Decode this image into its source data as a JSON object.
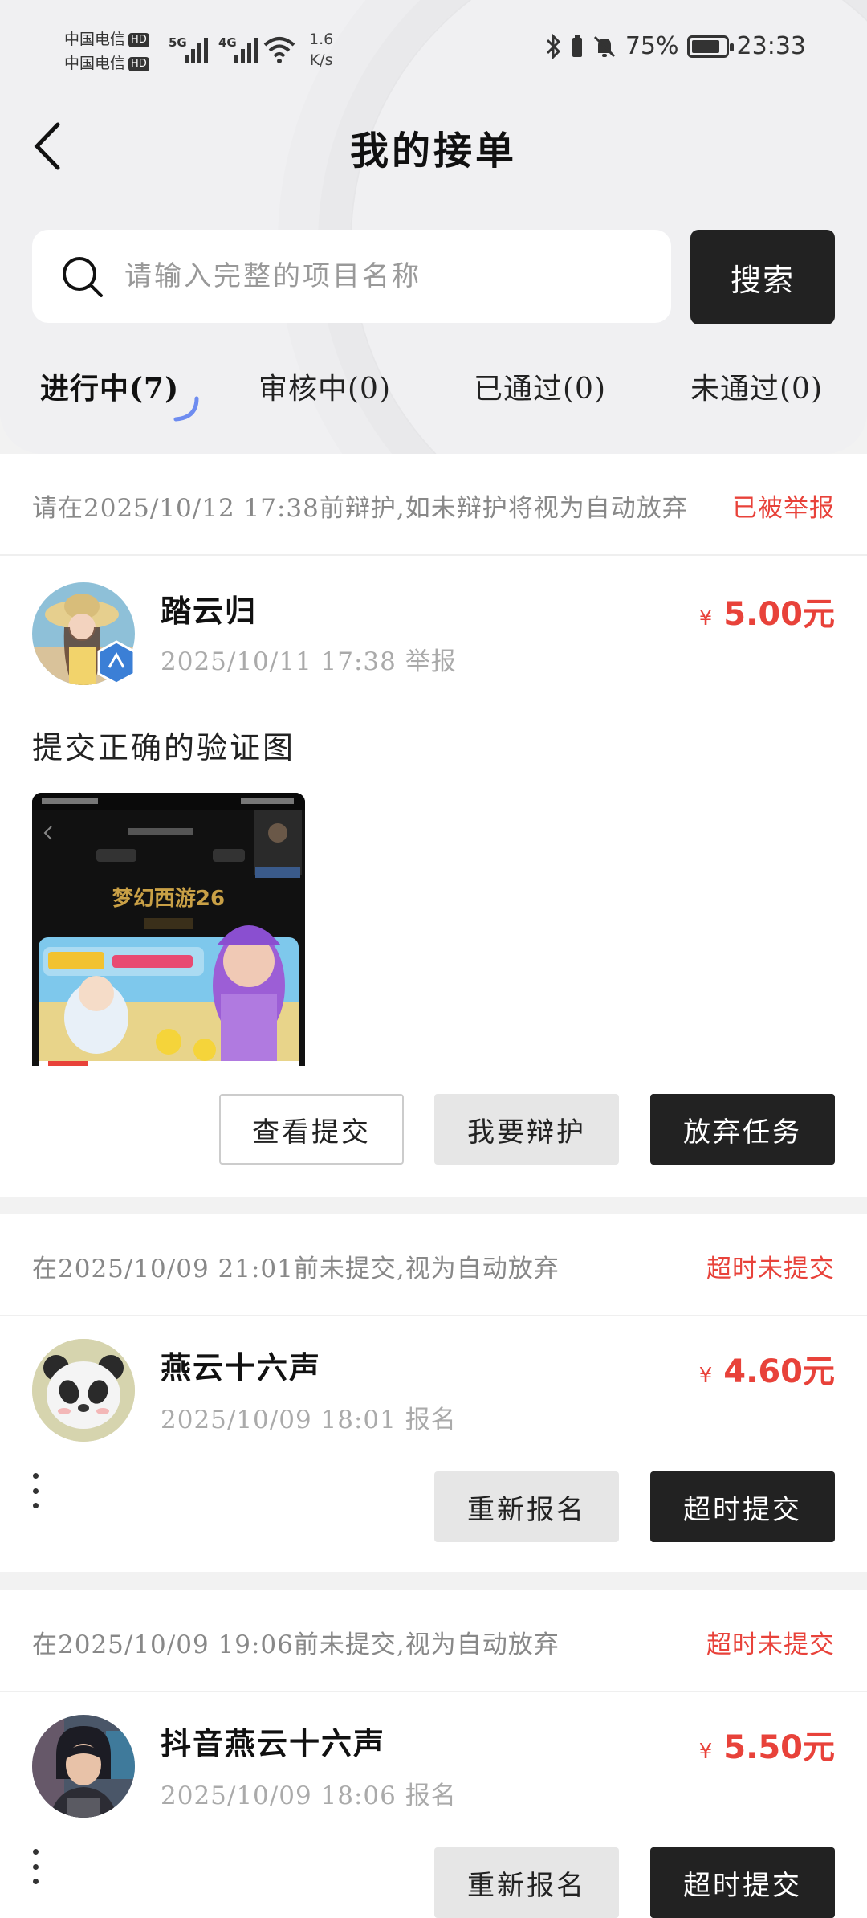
{
  "status_bar": {
    "carrier_1": "中国电信",
    "carrier_2": "中国电信",
    "hd": "HD",
    "sig1_label": "5G",
    "sig2_label": "4G",
    "net_speed_value": "1.6",
    "net_speed_unit": "K/s",
    "battery": "75%",
    "time": "23:33"
  },
  "header": {
    "back_icon": "chevron-left-icon",
    "title": "我的接单"
  },
  "search": {
    "placeholder": "请输入完整的项目名称",
    "value": "",
    "button_label": "搜索"
  },
  "tabs": [
    {
      "label": "进行中(7)",
      "active": true
    },
    {
      "label": "审核中(0)",
      "active": false
    },
    {
      "label": "已通过(0)",
      "active": false
    },
    {
      "label": "未通过(0)",
      "active": false
    }
  ],
  "orders": [
    {
      "notice": "请在2025/10/12 17:38前辩护,如未辩护将视为自动放弃",
      "status": "已被举报",
      "user_name": "踏云归",
      "meta": "2025/10/11 17:38 举报",
      "currency": "¥",
      "price": "5.00元",
      "section_title": "提交正确的验证图",
      "thumb_text": "梦幻西游26",
      "buttons": [
        "查看提交",
        "我要辩护",
        "放弃任务"
      ]
    },
    {
      "notice": "在2025/10/09 21:01前未提交,视为自动放弃",
      "status": "超时未提交",
      "user_name": "燕云十六声",
      "meta": "2025/10/09 18:01 报名",
      "currency": "¥",
      "price": "4.60元",
      "buttons": [
        "重新报名",
        "超时提交"
      ]
    },
    {
      "notice": "在2025/10/09 19:06前未提交,视为自动放弃",
      "status": "超时未提交",
      "user_name": "抖音燕云十六声",
      "meta": "2025/10/09 18:06 报名",
      "currency": "¥",
      "price": "5.50元",
      "buttons": [
        "重新报名",
        "超时提交"
      ]
    }
  ],
  "colors": {
    "accent_red": "#e8423a",
    "dark_button": "#222222",
    "gray_button": "#e6e6e6"
  }
}
